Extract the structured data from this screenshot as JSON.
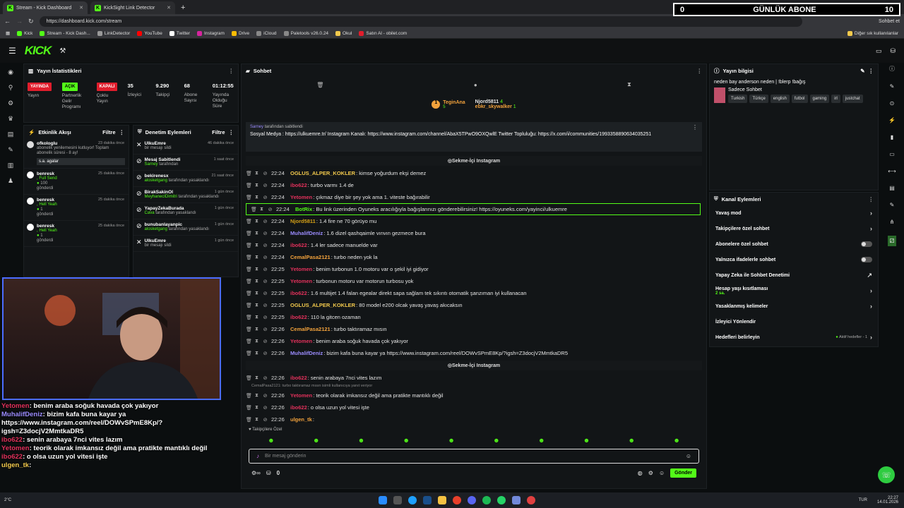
{
  "browser": {
    "tabs": [
      {
        "label": "Stream - Kick Dashboard"
      },
      {
        "label": "KickSight Link Detector"
      }
    ],
    "url": "https://dashboard.kick.com/stream",
    "bookmarks": [
      "Kick",
      "Stream - Kick Dash...",
      "LinkDetector",
      "YouTube",
      "Twitter",
      "Instagram",
      "Drive",
      "iCloud",
      "Paletools v26.0.24",
      "Okul",
      "Satın Al - obilet.com"
    ],
    "other_bookmarks": "Diğer sık kullanılanlar",
    "profile_label": "Sohbet et"
  },
  "overlay": {
    "abone_count": "0",
    "abone_label": "GÜNLÜK ABONE",
    "abone_goal": "10"
  },
  "stats": {
    "title": "Yayın İstatistikleri",
    "items": [
      {
        "tag": "YAYINDA",
        "label": "Yayın"
      },
      {
        "tag": "AÇIK",
        "label": "Partnerlik Gelir Programı"
      },
      {
        "tag": "KAPALI",
        "label": "Çoklu Yayın"
      }
    ],
    "numbers": [
      {
        "value": "35",
        "label": "İzleyici"
      },
      {
        "value": "9.290",
        "label": "Takipçi"
      },
      {
        "value": "68",
        "label": "Abone Sayısı"
      },
      {
        "value": "01:12:55",
        "label": "Yayında Olduğu Süre"
      }
    ]
  },
  "activity": {
    "title": "Etkinlik Akışı",
    "filter": "Filtre",
    "items": [
      {
        "name": "ofkologlu",
        "time": "23 dakika önce",
        "text": "abonelik yenilemesini kutluyor! Toplam abonelik süresi - 8 ay!",
        "note": "s.a. agalar"
      },
      {
        "name": "benresk",
        "time": "25 dakika önce",
        "text": ", Full Send",
        "sub": "100",
        "sub2": "gönderdi"
      },
      {
        "name": "benresk",
        "time": "25 dakika önce",
        "text": ", Hell Yeah",
        "sub": "1",
        "sub2": "gönderdi"
      },
      {
        "name": "benresk",
        "time": "25 dakika önce",
        "text": ", Hell Yeah",
        "sub": "1",
        "sub2": "gönderdi"
      }
    ]
  },
  "moderation": {
    "title": "Denetim Eylemleri",
    "filter": "Filtre",
    "items": [
      {
        "name": "UlkuEmre",
        "time": "46 dakika önce",
        "text": "bir mesajı sildi"
      },
      {
        "name": "Mesaj Sabitlendi",
        "time": "1 saat önce",
        "who": "Sarney",
        "text": "tarafından"
      },
      {
        "name": "bekirenesx",
        "time": "21 saat önce",
        "who": "alosketgang",
        "text": "tarafından yasaklandı"
      },
      {
        "name": "BirakSakinOl",
        "time": "1 gün önce",
        "who": "MeyhanecIDimitri",
        "text": "tarafından yasaklandı"
      },
      {
        "name": "YapayZekaBurada",
        "time": "1 gün önce",
        "who": "Cava",
        "text": "tarafından yasaklandı"
      },
      {
        "name": "bunubanlayanpic",
        "time": "1 gün önce",
        "who": "alosketgang",
        "text": "tarafından yasaklandı"
      },
      {
        "name": "UlkuEmre",
        "time": "1 gün önce",
        "text": "bir mesajı sildi"
      }
    ]
  },
  "chat": {
    "title": "Sohbet",
    "top_gifters": [
      {
        "name": "TeginAna",
        "count": "5"
      },
      {
        "name": "Njord5811",
        "count": "4"
      },
      {
        "name": "ebkr_skywalker",
        "count": "1"
      }
    ],
    "pinned": {
      "by": "Sarney",
      "by_label": "tarafından sabitlendi",
      "text": "Sosyal Medya : https://ulkuemre.tr/ Instagram Kanalı: https://www.instagram.com/channel/AbaX5TPwO9OXQwlE Twitter Topluluğu: https://x.com/i/communities/1993358890634035251"
    },
    "separator": "Sekme-İçi Instagram",
    "messages": [
      {
        "time": "22:24",
        "user": "OGLUS_ALPER_KOKLER",
        "color": "#f2c94c",
        "text": ": kimse yoğurdum ekşi demez"
      },
      {
        "time": "22:24",
        "user": "ibo622",
        "color": "#e1315b",
        "text": ": turbo varmı 1.4 de"
      },
      {
        "time": "22:24",
        "user": "Yetomen",
        "color": "#e1315b",
        "text": ": çıkmaz diye bir şey yok ama 1. viteste bağırabilir"
      },
      {
        "time": "22:24",
        "user": "BotRix",
        "color": "#53fc18",
        "text": ": Bu link üzerinden Oyuneks aracılığıyla bağışlarınızı gönderebilirsiniz! https://oyuneks.com/yayinci/ulkuemre",
        "highlight": true
      },
      {
        "time": "22:24",
        "user": "Njord5811",
        "color": "#d4a017",
        "text": ": 1.4 fire ne 70 görüyo mu"
      },
      {
        "time": "22:24",
        "user": "MuhalifDeniz",
        "color": "#9b8cff",
        "text": ": 1.6 dizel qashqaimle vınvın gezmece bura"
      },
      {
        "time": "22:24",
        "user": "ibo622",
        "color": "#e1315b",
        "text": ": 1.4 ler sadece manuelde var"
      },
      {
        "time": "22:24",
        "user": "CemalPasa2121",
        "color": "#f2a23c",
        "text": ": turbo neden yok la"
      },
      {
        "time": "22:25",
        "user": "Yetomen",
        "color": "#e1315b",
        "text": ": benim turbonun 1.0 motoru var o şekil iyi gidiyor"
      },
      {
        "time": "22:25",
        "user": "Yetomen",
        "color": "#e1315b",
        "text": ": turbonun motoru var motorun turbosu yok"
      },
      {
        "time": "22:25",
        "user": "ibo622",
        "color": "#e1315b",
        "text": ": 1.6 multijet 1.4 falan egealar direkt sapa sağlam tek sıkıntı otomatik şanzıman iyi kullanacan"
      },
      {
        "time": "22:25",
        "user": "OGLUS_ALPER_KOKLER",
        "color": "#f2c94c",
        "text": ": 80 model e200 olcak yavaş yavaş akıcaksın"
      },
      {
        "time": "22:25",
        "user": "ibo622",
        "color": "#e1315b",
        "text": ": 110 la gitcen ozaman"
      },
      {
        "time": "22:26",
        "user": "CemalPasa2121",
        "color": "#f2a23c",
        "text": ": turbo taktıramaz mısın"
      },
      {
        "time": "22:26",
        "user": "Yetomen",
        "color": "#e1315b",
        "text": ": benim araba soğuk havada çok yakıyor"
      },
      {
        "time": "22:26",
        "user": "MuhalifDeniz",
        "color": "#9b8cff",
        "text": ": bizim kafa buna kayar ya https://www.instagram.com/reel/DOWvSPmE8Kp/?igsh=Z3docjV2MmtkaDR5"
      }
    ],
    "messages2": [
      {
        "time": "22:26",
        "user": "ibo622",
        "color": "#e1315b",
        "text": ": senin arabaya 7nci vites lazım"
      },
      {
        "time": "22:26",
        "user": "Yetomen",
        "color": "#e1315b",
        "text": ": teorik olarak imkansız değil ama pratikte mantıklı değil",
        "reply": "CemalPasa2121: turbo taktıramaz mısın isimli kullanıcıya yanıt veriyor"
      },
      {
        "time": "22:26",
        "user": "ibo622",
        "color": "#e1315b",
        "text": ": o olsa uzun yol vitesi işte"
      },
      {
        "time": "22:26",
        "user": "ulgen_tk",
        "color": "#f2a23c",
        "text": ":"
      }
    ],
    "followers_only": "Takipçilere Özel",
    "input_placeholder": "Bir mesaj gönderin",
    "send": "Gönder",
    "count": "0"
  },
  "info": {
    "title": "Yayın bilgisi",
    "stream_title": "neden bay anderson neden | !blerp !bağış",
    "category": "Sadece Sohbet",
    "tags": [
      "Turkish",
      "Türkçe",
      "english",
      "futbol",
      "gaming",
      "irl",
      "justchat"
    ]
  },
  "channel": {
    "title": "Kanal Eylemleri",
    "items": [
      {
        "label": "Yavaş mod",
        "kind": "arrow"
      },
      {
        "label": "Takipçilere özel sohbet",
        "kind": "arrow"
      },
      {
        "label": "Abonelere özel sohbet",
        "kind": "toggle"
      },
      {
        "label": "Yalnızca ifadelerle sohbet",
        "kind": "toggle"
      },
      {
        "label": "Yapay Zeka ile Sohbet Denetimi",
        "kind": "link"
      },
      {
        "label": "Hesap yaşı kısıtlaması",
        "sub": "2 sa.",
        "kind": "arrow"
      },
      {
        "label": "Yasaklanmış kelimeler",
        "kind": "arrow"
      },
      {
        "label": "İzleyici Yönlendir",
        "kind": "none"
      },
      {
        "label": "Hedefleri belirleyin",
        "status": "Aktif hedefler - 1",
        "kind": "arrow"
      }
    ]
  },
  "overlay_chat": [
    {
      "user": "Yetomen",
      "color": "#e1315b",
      "text": ": benim araba soğuk havada çok yakıyor"
    },
    {
      "user": "MuhalifDeniz",
      "color": "#9b8cff",
      "text": ": bizim kafa buna kayar ya https://www.instagram.com/reel/DOWvSPmE8Kp/?igsh=Z3docjV2MmtkaDR5"
    },
    {
      "user": "ibo622",
      "color": "#e1315b",
      "text": ": senin arabaya 7nci vites lazım"
    },
    {
      "user": "Yetomen",
      "color": "#e1315b",
      "text": ": teorik olarak imkansız değil ama pratikte mantıklı değil"
    },
    {
      "user": "ibo622",
      "color": "#e1315b",
      "text": ": o olsa uzun yol vitesi işte"
    },
    {
      "user": "ulgen_tk",
      "color": "#f2c94c",
      "text": ":"
    }
  ],
  "taskbar": {
    "weather": "2°C",
    "lang": "TUR",
    "time": "22:27",
    "date": "14.01.2026"
  }
}
